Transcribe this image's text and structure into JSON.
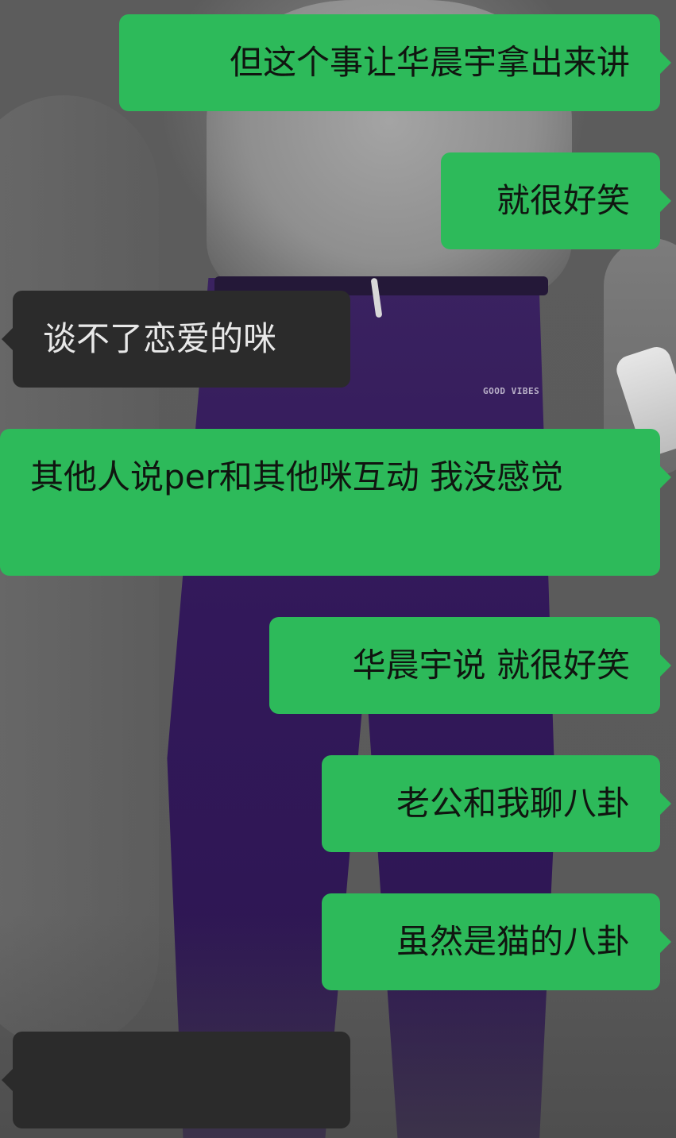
{
  "wallpaper": {
    "logo_text": "GOOD VIBES"
  },
  "messages": [
    {
      "side": "out",
      "text": "但这个事让华晨宇拿出来讲"
    },
    {
      "side": "out",
      "text": "就很好笑"
    },
    {
      "side": "in",
      "text": "谈不了恋爱的咪"
    },
    {
      "side": "out",
      "text": "其他人说per和其他咪互动 我没感觉"
    },
    {
      "side": "out",
      "text": "华晨宇说 就很好笑"
    },
    {
      "side": "out",
      "text": "老公和我聊八卦"
    },
    {
      "side": "out",
      "text": "虽然是猫的八卦"
    },
    {
      "side": "in",
      "text": ""
    }
  ],
  "colors": {
    "outgoing_bubble": "#2dba5a",
    "incoming_bubble": "#2b2b2b",
    "outgoing_text": "#101510",
    "incoming_text": "#e8e8e8"
  }
}
